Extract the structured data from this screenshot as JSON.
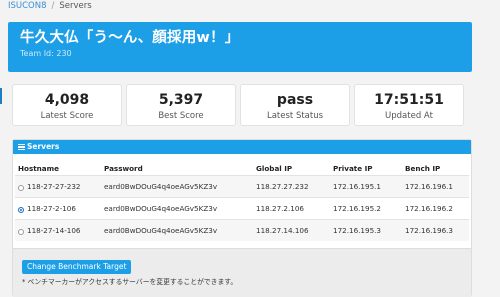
{
  "breadcrumb": {
    "home": "ISUCON8",
    "sep": "/",
    "current": "Servers"
  },
  "team": {
    "name": "牛久大仏「う〜ん、顔採用w！」",
    "id_text": "Team Id: 230"
  },
  "stats": [
    {
      "value": "4,098",
      "label": "Latest Score"
    },
    {
      "value": "5,397",
      "label": "Best Score"
    },
    {
      "value": "pass",
      "label": "Latest Status"
    },
    {
      "value": "17:51:51",
      "label": "Updated At"
    }
  ],
  "servers_panel": {
    "title": "Servers",
    "columns": [
      "Hostname",
      "Password",
      "Global IP",
      "Private IP",
      "Bench IP"
    ],
    "rows": [
      {
        "hostname": "118-27-27-232",
        "password": "eard0BwDOuG4q4oeAGv5KZ3v",
        "global_ip": "118.27.27.232",
        "private_ip": "172.16.195.1",
        "bench_ip": "172.16.196.1",
        "selected": false
      },
      {
        "hostname": "118-27-2-106",
        "password": "eard0BwDOuG4q4oeAGv5KZ3v",
        "global_ip": "118.27.2.106",
        "private_ip": "172.16.195.2",
        "bench_ip": "172.16.196.2",
        "selected": true
      },
      {
        "hostname": "118-27-14-106",
        "password": "eard0BwDOuG4q4oeAGv5KZ3v",
        "global_ip": "118.27.14.106",
        "private_ip": "172.16.195.3",
        "bench_ip": "172.16.196.3",
        "selected": false
      }
    ],
    "change_button": "Change Benchmark Target",
    "note": "* ベンチマーカーがアクセスするサーバーを変更することができます。"
  },
  "colors": {
    "accent": "#1d9fe8",
    "radio_selected": "#1c6bd6"
  }
}
